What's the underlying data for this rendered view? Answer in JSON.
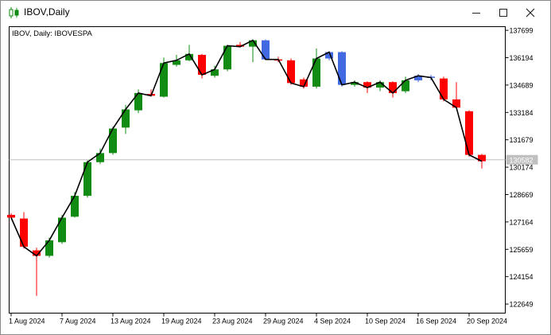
{
  "window": {
    "title": "IBOV,Daily",
    "icons": {
      "app": "candlestick-chart-icon",
      "minimize": "minimize-icon",
      "maximize": "maximize-icon",
      "close": "close-icon"
    }
  },
  "chart_data": {
    "type": "candlestick",
    "label": "IBOV, Daily:  IBOVESPA",
    "ylim": [
      122150,
      137900
    ],
    "y_ticks": [
      "137699",
      "136194",
      "134689",
      "133184",
      "131679",
      "130174",
      "128669",
      "127164",
      "125659",
      "124154",
      "122649"
    ],
    "x_ticks": [
      {
        "index": 0,
        "label": "1 Aug 2024"
      },
      {
        "index": 4,
        "label": "7 Aug 2024"
      },
      {
        "index": 8,
        "label": "13 Aug 2024"
      },
      {
        "index": 12,
        "label": "19 Aug 2024"
      },
      {
        "index": 16,
        "label": "23 Aug 2024"
      },
      {
        "index": 20,
        "label": "29 Aug 2024"
      },
      {
        "index": 24,
        "label": "4 Sep 2024"
      },
      {
        "index": 28,
        "label": "10 Sep 2024"
      },
      {
        "index": 32,
        "label": "16 Sep 2024"
      },
      {
        "index": 36,
        "label": "20 Sep 2024"
      }
    ],
    "current_price": {
      "value": 130582,
      "label": "130582"
    },
    "colors": {
      "bull": "#118b11",
      "bear": "#ff0000",
      "neutral": "#4169e1",
      "line": "#000000",
      "price_line": "#c0c0c0",
      "price_label_bg": "#c0c0c0"
    },
    "candles": [
      {
        "open": 127550,
        "high": 127650,
        "low": 127350,
        "close": 127400,
        "color": "bear"
      },
      {
        "open": 127350,
        "high": 127700,
        "low": 125700,
        "close": 125800,
        "color": "bear"
      },
      {
        "open": 125600,
        "high": 125750,
        "low": 123100,
        "close": 125300,
        "color": "bear"
      },
      {
        "open": 125300,
        "high": 126300,
        "low": 125200,
        "close": 126150,
        "color": "bull"
      },
      {
        "open": 126050,
        "high": 127550,
        "low": 125950,
        "close": 127400,
        "color": "bull"
      },
      {
        "open": 127450,
        "high": 128800,
        "low": 127400,
        "close": 128600,
        "color": "bull"
      },
      {
        "open": 128600,
        "high": 130550,
        "low": 128500,
        "close": 130450,
        "color": "bull"
      },
      {
        "open": 130450,
        "high": 131200,
        "low": 130350,
        "close": 130950,
        "color": "bull"
      },
      {
        "open": 130950,
        "high": 132400,
        "low": 130850,
        "close": 132300,
        "color": "bull"
      },
      {
        "open": 132350,
        "high": 133600,
        "low": 132000,
        "close": 133350,
        "color": "bull"
      },
      {
        "open": 133300,
        "high": 134450,
        "low": 133150,
        "close": 134250,
        "color": "bull"
      },
      {
        "open": 134200,
        "high": 134450,
        "low": 134050,
        "close": 134100,
        "color": "bear"
      },
      {
        "open": 134050,
        "high": 136200,
        "low": 134000,
        "close": 135900,
        "color": "bull"
      },
      {
        "open": 135800,
        "high": 136350,
        "low": 135700,
        "close": 136050,
        "color": "bull"
      },
      {
        "open": 136050,
        "high": 136900,
        "low": 136000,
        "close": 136400,
        "color": "bull"
      },
      {
        "open": 136350,
        "high": 136400,
        "low": 135050,
        "close": 135250,
        "color": "bear"
      },
      {
        "open": 135200,
        "high": 135750,
        "low": 135100,
        "close": 135550,
        "color": "bull"
      },
      {
        "open": 135550,
        "high": 136900,
        "low": 135450,
        "close": 136850,
        "color": "bull"
      },
      {
        "open": 136900,
        "high": 137050,
        "low": 136750,
        "close": 136800,
        "color": "bear"
      },
      {
        "open": 136800,
        "high": 137200,
        "low": 135950,
        "close": 137150,
        "color": "bull"
      },
      {
        "open": 137150,
        "high": 137200,
        "low": 136100,
        "close": 136100,
        "color": "neutral"
      },
      {
        "open": 136100,
        "high": 136250,
        "low": 135950,
        "close": 136100,
        "color": "bear"
      },
      {
        "open": 136050,
        "high": 136150,
        "low": 134700,
        "close": 134800,
        "color": "bear"
      },
      {
        "open": 135000,
        "high": 135100,
        "low": 134500,
        "close": 134600,
        "color": "bear"
      },
      {
        "open": 134600,
        "high": 136700,
        "low": 134500,
        "close": 136150,
        "color": "bull"
      },
      {
        "open": 136150,
        "high": 136550,
        "low": 136050,
        "close": 136500,
        "color": "neutral"
      },
      {
        "open": 136500,
        "high": 136550,
        "low": 134600,
        "close": 134700,
        "color": "neutral"
      },
      {
        "open": 134700,
        "high": 134950,
        "low": 134600,
        "close": 134850,
        "color": "bull"
      },
      {
        "open": 134850,
        "high": 134900,
        "low": 134250,
        "close": 134550,
        "color": "bear"
      },
      {
        "open": 134550,
        "high": 134950,
        "low": 134350,
        "close": 134850,
        "color": "bull"
      },
      {
        "open": 134850,
        "high": 134900,
        "low": 134000,
        "close": 134250,
        "color": "bear"
      },
      {
        "open": 134350,
        "high": 135150,
        "low": 134250,
        "close": 134950,
        "color": "bull"
      },
      {
        "open": 134950,
        "high": 135300,
        "low": 134850,
        "close": 135200,
        "color": "neutral"
      },
      {
        "open": 135150,
        "high": 135250,
        "low": 134950,
        "close": 135100,
        "color": "neutral"
      },
      {
        "open": 135050,
        "high": 135150,
        "low": 133800,
        "close": 133900,
        "color": "bear"
      },
      {
        "open": 133900,
        "high": 134850,
        "low": 133350,
        "close": 133450,
        "color": "bear"
      },
      {
        "open": 133250,
        "high": 133300,
        "low": 130750,
        "close": 130850,
        "color": "bear"
      },
      {
        "open": 130850,
        "high": 130900,
        "low": 130100,
        "close": 130500,
        "color": "bear"
      }
    ]
  }
}
